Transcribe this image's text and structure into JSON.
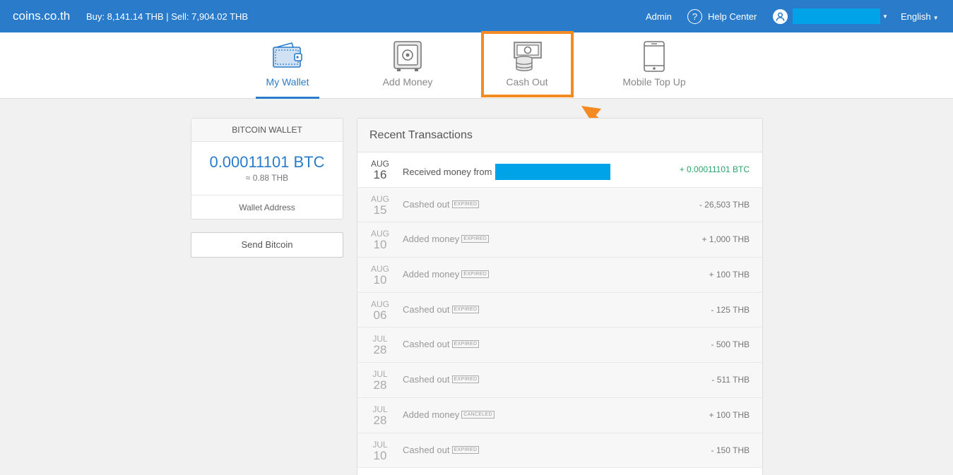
{
  "header": {
    "brand": "coins.co.th",
    "rates": "Buy: 8,141.14 THB | Sell: 7,904.02 THB",
    "admin": "Admin",
    "help_center": "Help Center",
    "language": "English"
  },
  "nav": {
    "tabs": [
      {
        "label": "My Wallet",
        "icon": "wallet-icon",
        "active": true
      },
      {
        "label": "Add Money",
        "icon": "safe-icon",
        "active": false
      },
      {
        "label": "Cash Out",
        "icon": "cash-out-icon",
        "active": false
      },
      {
        "label": "Mobile Top Up",
        "icon": "mobile-phone-icon",
        "active": false
      }
    ]
  },
  "wallet": {
    "title": "BITCOIN WALLET",
    "balance": "0.00011101 BTC",
    "balance_thb": "≈ 0.88 THB",
    "address_link": "Wallet Address",
    "send_button": "Send Bitcoin"
  },
  "transactions": {
    "title": "Recent Transactions",
    "rows": [
      {
        "month": "AUG",
        "day": "16",
        "desc": "Received money from",
        "status": "",
        "amount": "+ 0.00011101 BTC",
        "redacted": true
      },
      {
        "month": "AUG",
        "day": "15",
        "desc": "Cashed out",
        "status": "EXPIRED",
        "amount": "- 26,503 THB"
      },
      {
        "month": "AUG",
        "day": "10",
        "desc": "Added money",
        "status": "EXPIRED",
        "amount": "+ 1,000 THB"
      },
      {
        "month": "AUG",
        "day": "10",
        "desc": "Added money",
        "status": "EXPIRED",
        "amount": "+ 100 THB"
      },
      {
        "month": "AUG",
        "day": "06",
        "desc": "Cashed out",
        "status": "EXPIRED",
        "amount": "- 125 THB"
      },
      {
        "month": "JUL",
        "day": "28",
        "desc": "Cashed out",
        "status": "EXPIRED",
        "amount": "- 500 THB"
      },
      {
        "month": "JUL",
        "day": "28",
        "desc": "Cashed out",
        "status": "EXPIRED",
        "amount": "- 511 THB"
      },
      {
        "month": "JUL",
        "day": "28",
        "desc": "Added money",
        "status": "CANCELED",
        "amount": "+ 100 THB"
      },
      {
        "month": "JUL",
        "day": "10",
        "desc": "Cashed out",
        "status": "EXPIRED",
        "amount": "- 150 THB"
      }
    ]
  },
  "colors": {
    "topbar": "#2a7ccb",
    "highlight": "#f48b22",
    "positive": "#2ba36a",
    "redaction": "#00a3e8"
  }
}
